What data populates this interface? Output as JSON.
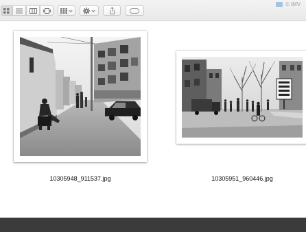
{
  "toolbar": {
    "view_modes": [
      "icon-view",
      "list-view",
      "column-view",
      "gallery-view"
    ],
    "group_menu_icon": "arrange-grid-icon",
    "action_menu_icon": "gear-icon",
    "share_icon": "share-icon",
    "tag_icon": "tag-icon",
    "device_label": "© iMV"
  },
  "files": [
    {
      "name": "10305948_911537.jpg",
      "subject": "street-scene-man-seated-vertical"
    },
    {
      "name": "10305951_960446.jpg",
      "subject": "street-scene-crowd-horizontal"
    }
  ],
  "colors": {
    "toolbar_bg": "#ececec",
    "statusbar_bg": "#3b3b3b",
    "accent_folder": "#9ec4e6"
  }
}
